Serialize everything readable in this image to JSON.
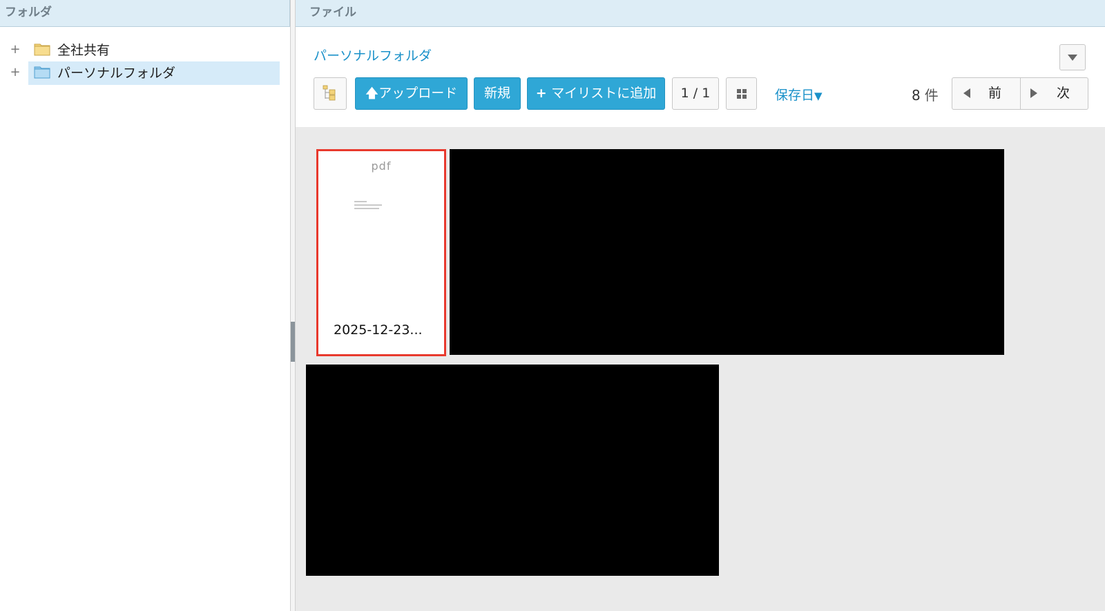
{
  "left_pane": {
    "header": "フォルダ",
    "tree": [
      {
        "label": "全社共有",
        "expander": "+",
        "icon": "folder-icon",
        "icon_color": "#f3d37a",
        "selected": false
      },
      {
        "label": "パーソナルフォルダ",
        "expander": "+",
        "icon": "folder-icon",
        "icon_color": "#a8d4f0",
        "selected": true
      }
    ]
  },
  "right_pane": {
    "header": "ファイル",
    "breadcrumb": "パーソナルフォルダ",
    "toolbar": {
      "tree_toggle_icon": "folder-tree-icon",
      "upload_label": "アップロード",
      "new_label": "新規",
      "add_mylist_label": "マイリストに追加",
      "page_indicator": "1 / 1",
      "view_toggle_icon": "grid-view-icon",
      "sort_label": "保存日",
      "sort_arrow": "▼",
      "count": "8",
      "count_unit": "件",
      "prev_label": "前",
      "next_label": "次"
    },
    "files": [
      {
        "type": "pdf",
        "name": "2025-12-23...",
        "selected": true
      }
    ]
  },
  "colors": {
    "accent": "#2fa7d6",
    "link": "#1a91c9",
    "header_bg": "#ddedf6",
    "selection_border": "#e8392d",
    "content_bg": "#eaeaea"
  }
}
